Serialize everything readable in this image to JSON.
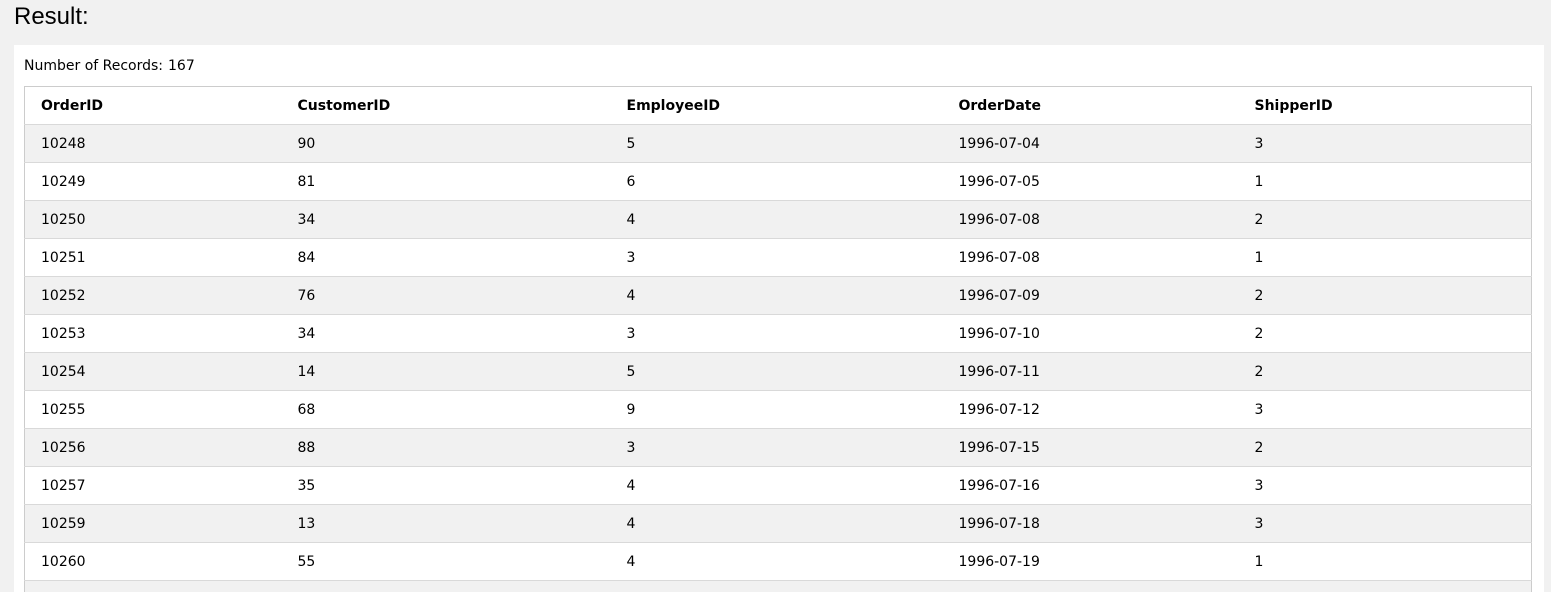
{
  "heading": "Result:",
  "records": {
    "label": "Number of Records:",
    "count": "167"
  },
  "table": {
    "columns": [
      "OrderID",
      "CustomerID",
      "EmployeeID",
      "OrderDate",
      "ShipperID"
    ],
    "rows": [
      [
        "10248",
        "90",
        "5",
        "1996-07-04",
        "3"
      ],
      [
        "10249",
        "81",
        "6",
        "1996-07-05",
        "1"
      ],
      [
        "10250",
        "34",
        "4",
        "1996-07-08",
        "2"
      ],
      [
        "10251",
        "84",
        "3",
        "1996-07-08",
        "1"
      ],
      [
        "10252",
        "76",
        "4",
        "1996-07-09",
        "2"
      ],
      [
        "10253",
        "34",
        "3",
        "1996-07-10",
        "2"
      ],
      [
        "10254",
        "14",
        "5",
        "1996-07-11",
        "2"
      ],
      [
        "10255",
        "68",
        "9",
        "1996-07-12",
        "3"
      ],
      [
        "10256",
        "88",
        "3",
        "1996-07-15",
        "2"
      ],
      [
        "10257",
        "35",
        "4",
        "1996-07-16",
        "3"
      ],
      [
        "10259",
        "13",
        "4",
        "1996-07-18",
        "3"
      ],
      [
        "10260",
        "55",
        "4",
        "1996-07-19",
        "1"
      ],
      [
        "",
        "",
        "",
        "",
        ""
      ]
    ]
  }
}
